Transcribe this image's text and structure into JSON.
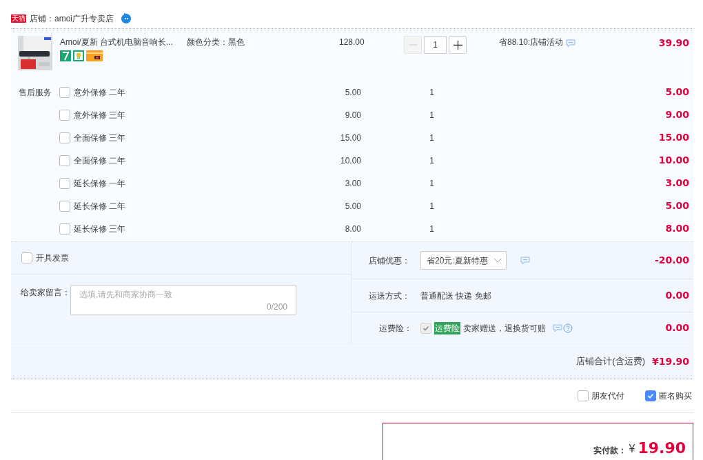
{
  "shop": {
    "badge": "天猫",
    "name": "店铺：amoi广升专卖店"
  },
  "item": {
    "title": "Amoi/夏新 台式机电脑音响长...",
    "spec": "颜色分类：黑色",
    "price": "128.00",
    "quantity": "1",
    "decrement_disabled": true,
    "promo": "省88.10:店铺活动",
    "total": "39.90"
  },
  "services": {
    "label": "售后服务",
    "rows": [
      {
        "name": "意外保修 二年",
        "price": "5.00",
        "quantity": "1",
        "total": "5.00",
        "checked": false
      },
      {
        "name": "意外保修 三年",
        "price": "9.00",
        "quantity": "1",
        "total": "9.00",
        "checked": false
      },
      {
        "name": "全面保修 三年",
        "price": "15.00",
        "quantity": "1",
        "total": "15.00",
        "checked": false
      },
      {
        "name": "全面保修 二年",
        "price": "10.00",
        "quantity": "1",
        "total": "10.00",
        "checked": false
      },
      {
        "name": "延长保修 一年",
        "price": "3.00",
        "quantity": "1",
        "total": "3.00",
        "checked": false
      },
      {
        "name": "延长保修 二年",
        "price": "5.00",
        "quantity": "1",
        "total": "5.00",
        "checked": false
      },
      {
        "name": "延长保修 三年",
        "price": "8.00",
        "quantity": "1",
        "total": "8.00",
        "checked": false
      }
    ]
  },
  "invoice": {
    "label": "开具发票",
    "checked": false
  },
  "message": {
    "label": "给卖家留言：",
    "placeholder": "选填,请先和商家协商一致",
    "counter": "0/200"
  },
  "discount": {
    "label": "店铺优惠：",
    "value": "省20元:夏新特惠",
    "amount": "-20.00"
  },
  "shipping": {
    "label": "运送方式：",
    "value": "普通配送 快递 免邮",
    "amount": "0.00"
  },
  "insurance": {
    "label": "运费险：",
    "checked": true,
    "disabled": true,
    "badge": "运费险",
    "value": "卖家赠送，退换货可赔",
    "amount": "0.00"
  },
  "subtotal": {
    "label": "店铺合计(含运费)",
    "amount": "¥19.90"
  },
  "options": [
    {
      "label": "朋友代付",
      "checked": false
    },
    {
      "label": "匿名购买",
      "checked": true
    }
  ],
  "payment": {
    "label": "实付款：",
    "currency": "¥",
    "amount": "19.90"
  }
}
